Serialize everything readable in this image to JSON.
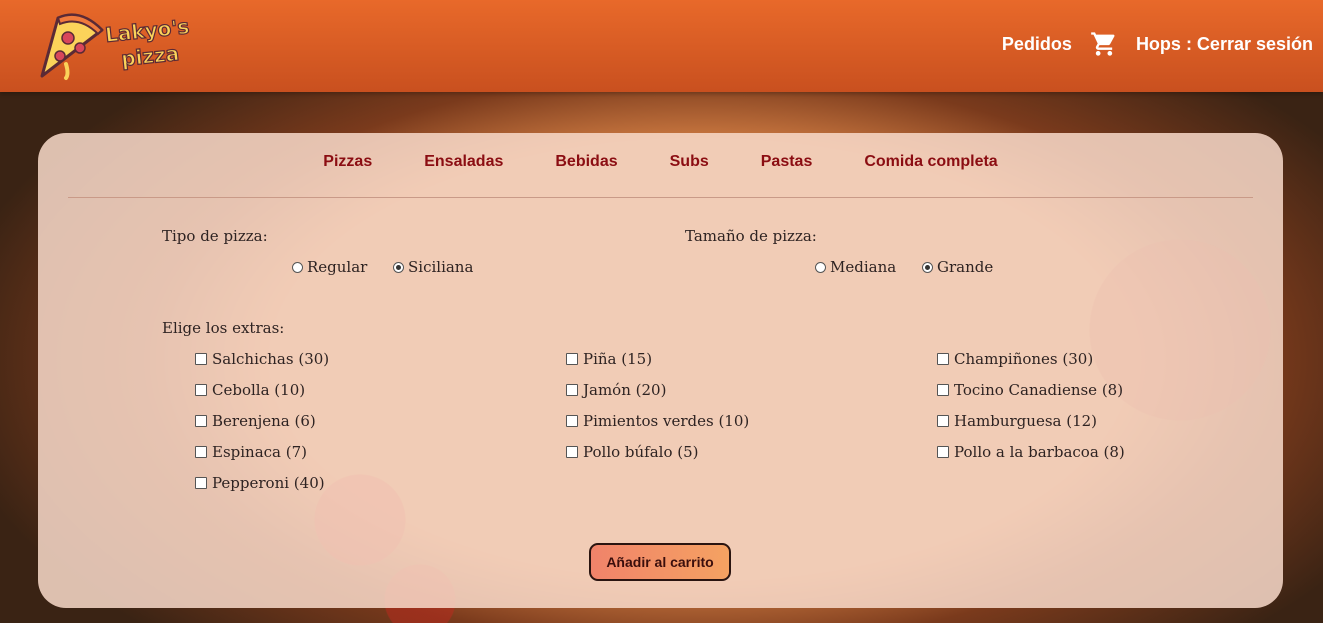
{
  "header": {
    "logo_text_line1": "Lakyo's",
    "logo_text_line2": "pizza",
    "orders_label": "Pedidos",
    "cart_icon": "cart-icon",
    "session_label": "Hops : Cerrar sesión"
  },
  "tabs": [
    "Pizzas",
    "Ensaladas",
    "Bebidas",
    "Subs",
    "Pastas",
    "Comida completa"
  ],
  "pizza_type": {
    "label": "Tipo de pizza:",
    "options": [
      "Regular",
      "Siciliana"
    ],
    "selected": "Siciliana"
  },
  "pizza_size": {
    "label": "Tamaño de pizza:",
    "options": [
      "Mediana",
      "Grande"
    ],
    "selected": "Grande"
  },
  "extras": {
    "label": "Elige los extras:",
    "columns": [
      [
        "Salchichas (30)",
        "Cebolla (10)",
        "Berenjena (6)",
        "Espinaca (7)",
        "Pepperoni (40)"
      ],
      [
        "Piña (15)",
        "Jamón (20)",
        "Pimientos verdes (10)",
        "Pollo búfalo (5)"
      ],
      [
        "Champiñones (30)",
        "Tocino Canadiense (8)",
        "Hamburguesa (12)",
        "Pollo a la barbacoa (8)"
      ]
    ]
  },
  "add_button": "Añadir al carrito",
  "colors": {
    "header": "#e8692a",
    "tab_text": "#8b0d12",
    "card": "#f8dacb",
    "button": "#f0836a"
  }
}
